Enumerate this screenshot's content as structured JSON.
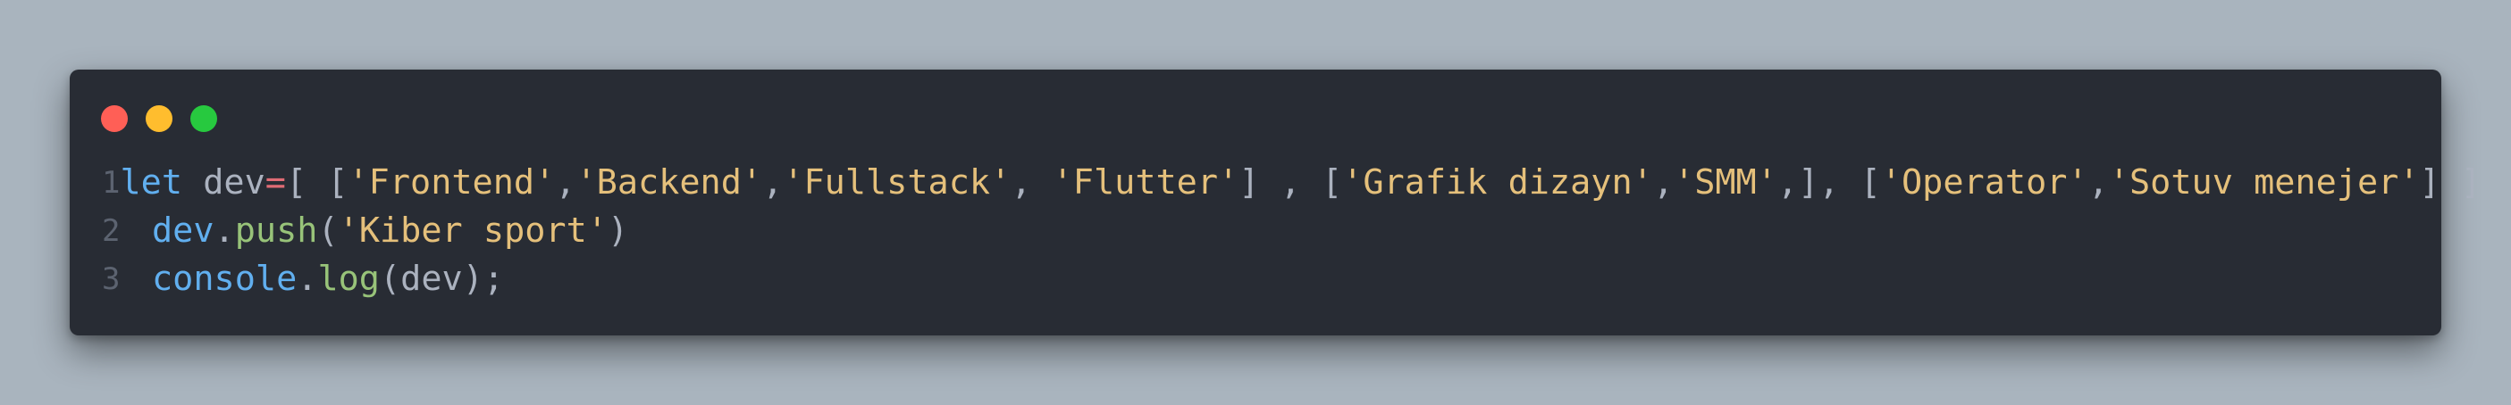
{
  "window": {
    "controls": [
      {
        "name": "close",
        "color": "#ff5f56"
      },
      {
        "name": "minimize",
        "color": "#ffbd2e"
      },
      {
        "name": "maximize",
        "color": "#27c93f"
      }
    ]
  },
  "code": {
    "lines": [
      {
        "number": "1",
        "tokens": [
          {
            "t": "let",
            "k": "kw"
          },
          {
            "t": " dev",
            "k": "id"
          },
          {
            "t": "=",
            "k": "op"
          },
          {
            "t": "[ [",
            "k": "pun"
          },
          {
            "t": "'Frontend'",
            "k": "str"
          },
          {
            "t": ",",
            "k": "pun"
          },
          {
            "t": "'Backend'",
            "k": "str"
          },
          {
            "t": ",",
            "k": "pun"
          },
          {
            "t": "'Fullstack'",
            "k": "str"
          },
          {
            "t": ", ",
            "k": "pun"
          },
          {
            "t": "'Flutter'",
            "k": "str"
          },
          {
            "t": "] , [",
            "k": "pun"
          },
          {
            "t": "'Grafik dizayn'",
            "k": "str"
          },
          {
            "t": ",",
            "k": "pun"
          },
          {
            "t": "'SMM'",
            "k": "str"
          },
          {
            "t": ",], [",
            "k": "pun"
          },
          {
            "t": "'Operator'",
            "k": "str"
          },
          {
            "t": ",",
            "k": "pun"
          },
          {
            "t": "'Sotuv menejer'",
            "k": "str"
          },
          {
            "t": "] ]",
            "k": "pun"
          }
        ]
      },
      {
        "number": "2",
        "tokens": [
          {
            "t": "dev",
            "k": "obj"
          },
          {
            "t": ".",
            "k": "pun"
          },
          {
            "t": "push",
            "k": "fn"
          },
          {
            "t": "(",
            "k": "pun"
          },
          {
            "t": "'Kiber sport'",
            "k": "str"
          },
          {
            "t": ")",
            "k": "pun"
          }
        ]
      },
      {
        "number": "3",
        "tokens": [
          {
            "t": "console",
            "k": "obj"
          },
          {
            "t": ".",
            "k": "pun"
          },
          {
            "t": "log",
            "k": "fn"
          },
          {
            "t": "(dev);",
            "k": "pun"
          }
        ]
      }
    ]
  },
  "colors": {
    "background": "#a9b4be",
    "editor": "#282c34",
    "keyword": "#61afef",
    "string": "#e5c07b",
    "function": "#98c379",
    "operator": "#e06c75",
    "punctuation": "#abb2bf",
    "line_number": "#5c6370"
  }
}
